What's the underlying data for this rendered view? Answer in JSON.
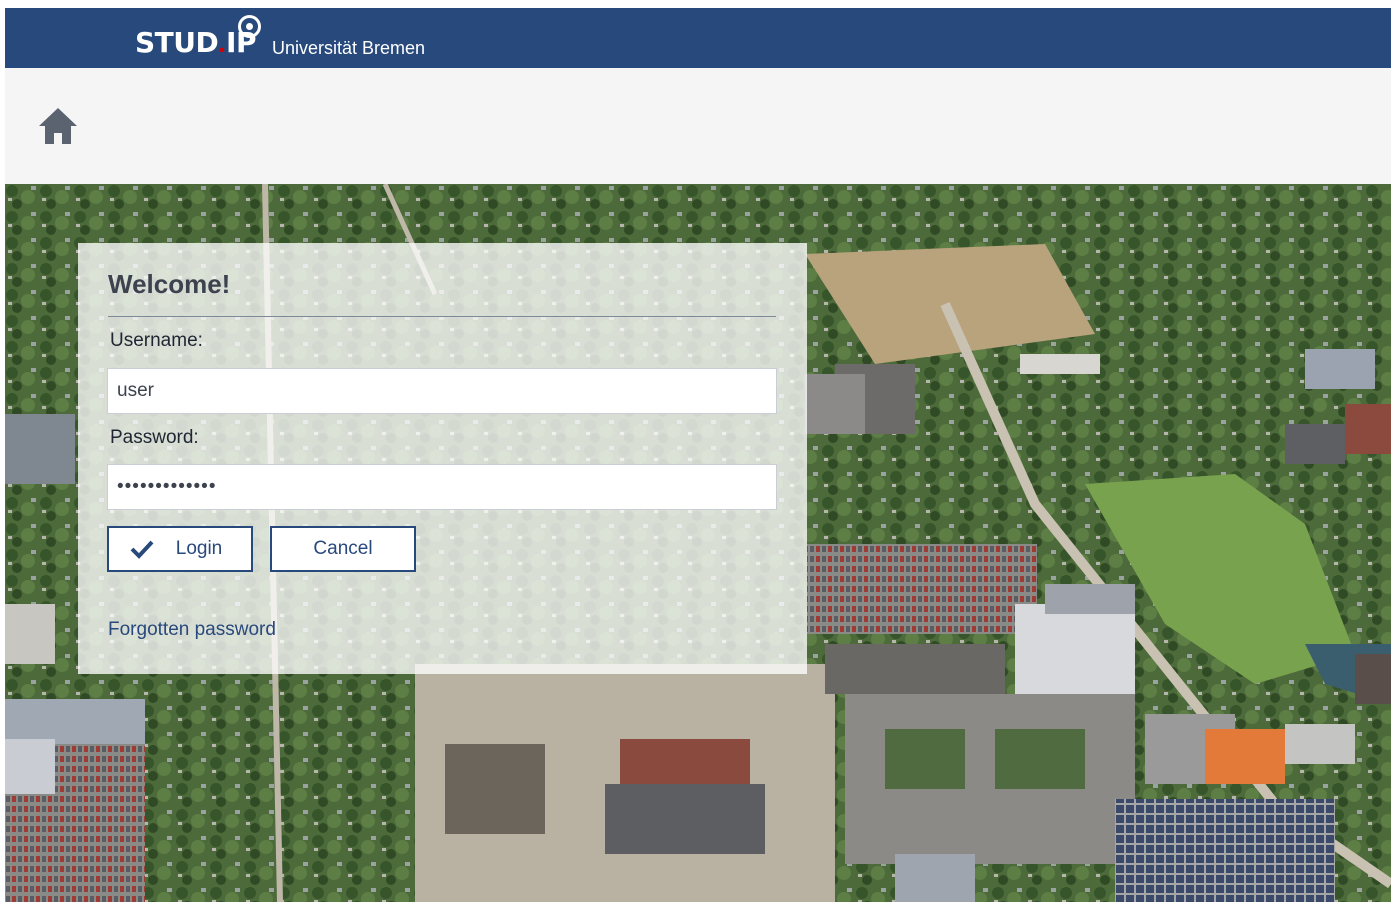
{
  "header": {
    "logo_main": "STUD",
    "logo_dot": ".",
    "logo_end": "IP",
    "university": "Universität Bremen"
  },
  "nav": {
    "home_icon": "home-icon"
  },
  "login": {
    "title": "Welcome!",
    "username_label": "Username:",
    "username_value": "user",
    "password_label": "Password:",
    "password_value": "•••••••••••••",
    "login_button": "Login",
    "cancel_button": "Cancel",
    "forgot_link": "Forgotten password"
  },
  "colors": {
    "brand_blue": "#28497c",
    "logo_red": "#d60000",
    "header_gray": "#f5f5f5"
  }
}
